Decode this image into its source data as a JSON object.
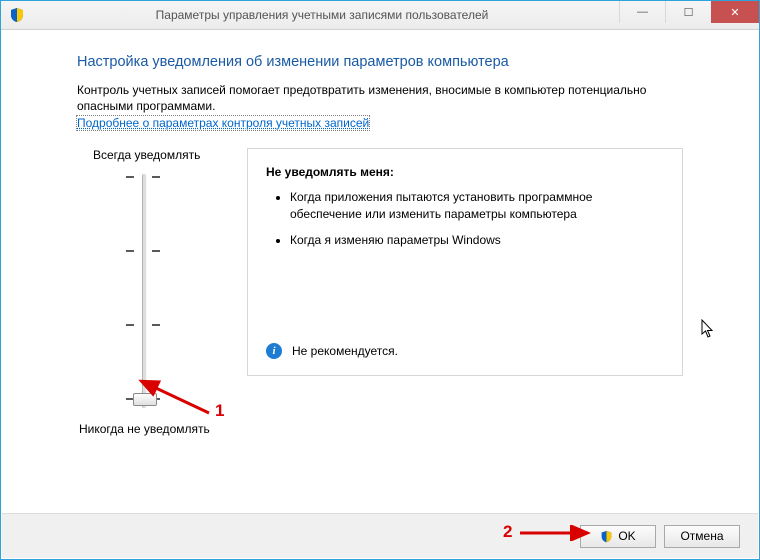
{
  "window": {
    "title": "Параметры управления учетными записями пользователей"
  },
  "heading": "Настройка уведомления об изменении параметров компьютера",
  "intro": "Контроль учетных записей помогает предотвратить изменения, вносимые в компьютер потенциально опасными программами.",
  "link": "Подробнее о параметрах контроля учетных записей",
  "slider": {
    "top": "Всегда уведомлять",
    "bottom": "Никогда не уведомлять",
    "level": 0,
    "levels_total": 4
  },
  "infobox": {
    "heading": "Не уведомлять меня:",
    "bullets": [
      "Когда приложения пытаются установить программное обеспечение или изменить параметры компьютера",
      "Когда я изменяю параметры Windows"
    ],
    "recommendation": "Не рекомендуется."
  },
  "buttons": {
    "ok": "OK",
    "cancel": "Отмена"
  },
  "annotations": {
    "a1": "1",
    "a2": "2"
  }
}
